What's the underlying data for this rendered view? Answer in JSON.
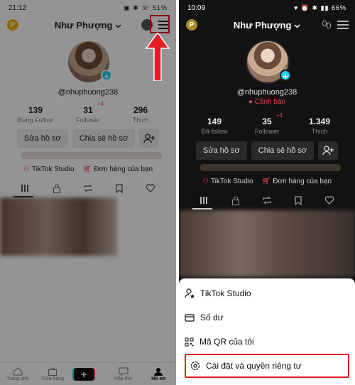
{
  "left": {
    "status_time": "21:12",
    "status_icons": "▣ ✱ ☏ 51%",
    "badge": "P",
    "username": "Như Phượng",
    "handle": "@nhuphuong238",
    "stats": [
      {
        "value": "139",
        "label": "Đang Follow"
      },
      {
        "value": "31",
        "label": "Follower",
        "badge": "+4"
      },
      {
        "value": "296",
        "label": "Thích"
      }
    ],
    "edit_button": "Sửa hồ sơ",
    "share_button": "Chia sẻ hồ sơ",
    "studio_link": "TikTok Studio",
    "orders_link": "Đơn hàng của bạn",
    "nav": [
      {
        "label": "Trang chủ"
      },
      {
        "label": "Cửa hàng"
      },
      {
        "label": ""
      },
      {
        "label": "Hộp thư"
      },
      {
        "label": "Hồ sơ"
      }
    ],
    "accent_red": "#e31b23"
  },
  "right": {
    "status_time": "10:09",
    "status_icons": "♥ ⏰ ✱ ▮▮ 66%",
    "badge": "P",
    "username": "Như Phượng",
    "handle": "@nhuphuong238",
    "warning": "Cảnh báo",
    "stats": [
      {
        "value": "149",
        "label": "Đã follow"
      },
      {
        "value": "35",
        "label": "Follower",
        "badge": "+4"
      },
      {
        "value": "1.349",
        "label": "Thích"
      }
    ],
    "edit_button": "Sửa hồ sơ",
    "share_button": "Chia sẻ hồ sơ",
    "studio_link": "TikTok Studio",
    "orders_link": "Đơn hàng của bạn",
    "menu": [
      {
        "label": "TikTok Studio",
        "icon": "studio-icon"
      },
      {
        "label": "Số dư",
        "icon": "wallet-icon"
      },
      {
        "label": "Mã QR của tôi",
        "icon": "qr-icon"
      },
      {
        "label": "Cài đặt và quyền riêng tư",
        "icon": "settings-icon"
      }
    ]
  }
}
